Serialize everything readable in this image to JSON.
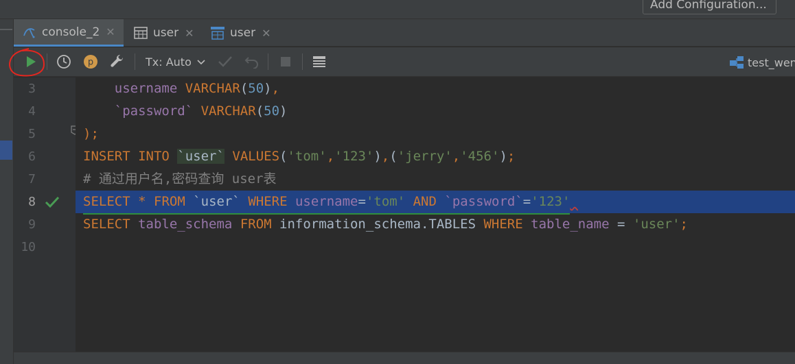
{
  "toolbar_top": {
    "add_configuration": "Add Configuration..."
  },
  "tabs": [
    {
      "label": "console_2",
      "close": "✕",
      "icon": "mysql-console-icon"
    },
    {
      "label": "user",
      "close": "✕",
      "icon": "table-icon"
    },
    {
      "label": "user",
      "close": "✕",
      "icon": "table-data-icon"
    }
  ],
  "toolbar": {
    "tx_mode": "Tx: Auto",
    "datasource": "test_wensi"
  },
  "gutter": {
    "line_numbers": [
      "3",
      "4",
      "5",
      "6",
      "7",
      "8",
      "9",
      "10"
    ]
  },
  "code": {
    "l3_col": "username",
    "l3_type": "VARCHAR",
    "l3_num": "50",
    "l4_col": "`password`",
    "l4_type": "VARCHAR",
    "l4_num": "50",
    "l5": ");",
    "l6_kw1": "INSERT INTO",
    "l6_tbl": "`user`",
    "l6_kw2": "VALUES",
    "l6_s1": "'tom'",
    "l6_s2": "'123'",
    "l6_s3": "'jerry'",
    "l6_s4": "'456'",
    "l7_comment": "# 通过用户名,密码查询 user表",
    "l8_select": "SELECT",
    "l8_star": "*",
    "l8_from": "FROM",
    "l8_tbl": "`user`",
    "l8_where": "WHERE",
    "l8_col1": "username",
    "l8_s1": "'tom'",
    "l8_and": "AND",
    "l8_col2": "`password`",
    "l8_s2": "'123'",
    "l9_select": "SELECT",
    "l9_col": "table_schema",
    "l9_from": "FROM",
    "l9_src": "information_schema.TABLES",
    "l9_where": "WHERE",
    "l9_col2": "table_name",
    "l9_eq": "=",
    "l9_s": "'user'",
    "l9_end": ";"
  },
  "colors": {
    "keyword": "#cc7832",
    "identifier": "#9876aa",
    "string": "#6a8759",
    "number": "#6897bb",
    "selection": "#214283"
  }
}
